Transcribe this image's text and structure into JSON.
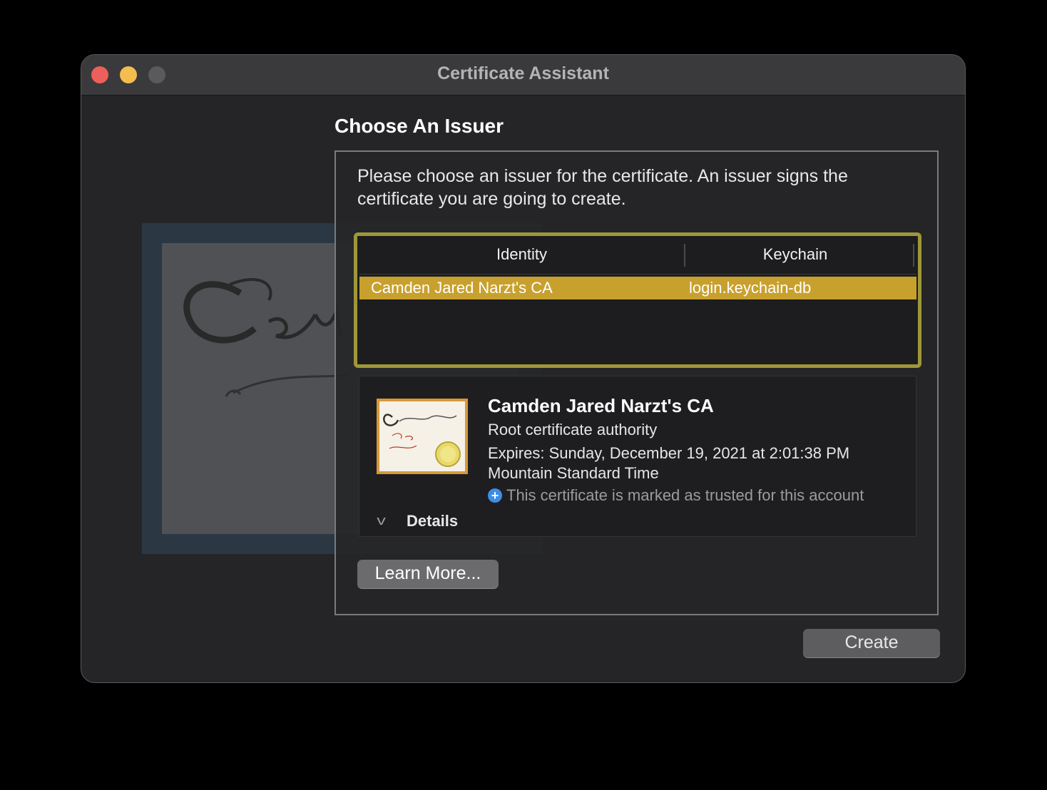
{
  "window": {
    "title": "Certificate Assistant"
  },
  "page": {
    "heading": "Choose An Issuer",
    "intro": "Please choose an issuer for the certificate. An issuer signs the certificate you are going to create."
  },
  "table": {
    "columns": [
      "Identity",
      "Keychain"
    ],
    "rows": [
      {
        "identity": "Camden Jared Narzt's CA",
        "keychain": "login.keychain-db",
        "selected": true
      }
    ]
  },
  "details": {
    "name": "Camden Jared Narzt's CA",
    "type": "Root certificate authority",
    "expires": "Expires: Sunday, December 19, 2021 at 2:01:38 PM Mountain Standard Time",
    "trust": "This certificate is marked as trusted for this account",
    "toggle_label": "Details",
    "icon": "certificate-icon"
  },
  "buttons": {
    "learn_more": "Learn More...",
    "create": "Create"
  },
  "colors": {
    "selection": "#c8a02d",
    "focus_ring": "#9e9739",
    "close": "#ec5f5a",
    "minimize": "#f3bd4f"
  }
}
